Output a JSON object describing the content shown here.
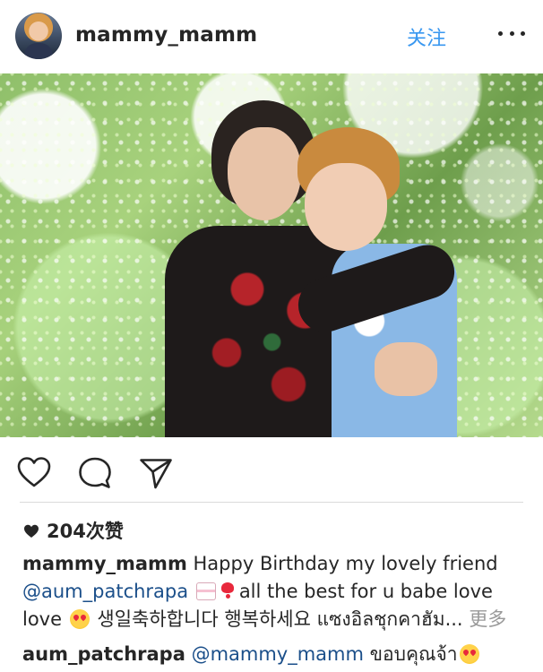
{
  "header": {
    "username": "mammy_mamm",
    "follow_label": "关注",
    "more_icon": "more-horizontal-icon"
  },
  "actions": {
    "like_icon": "heart-outline-icon",
    "comment_icon": "comment-bubble-icon",
    "share_icon": "send-paper-plane-icon"
  },
  "likes": {
    "text": "204次赞",
    "icon": "heart-filled-icon"
  },
  "caption": {
    "author": "mammy_mamm",
    "text_1": "Happy Birthday my lovely friend",
    "mention": "@aum_patchrapa",
    "emoji_cake": "birthday-cake-emoji",
    "emoji_heart": "heart-exclamation-emoji",
    "text_2": "all the best for u babe love love",
    "emoji_heart_eyes": "heart-eyes-emoji",
    "text_3": "생일축하합니다 행복하세요 แซงอิลชุกคาฮัม...",
    "more_label": "更多"
  },
  "comment": {
    "author": "aum_patchrapa",
    "mention": "@mammy_mamm",
    "text": "ขอบคุณจ้า",
    "emoji": "heart-eyes-emoji"
  },
  "colors": {
    "link_blue": "#3897f0",
    "mention_blue": "#1b4f8a",
    "text": "#262626",
    "muted": "#999999",
    "divider": "#dbdbdb"
  }
}
